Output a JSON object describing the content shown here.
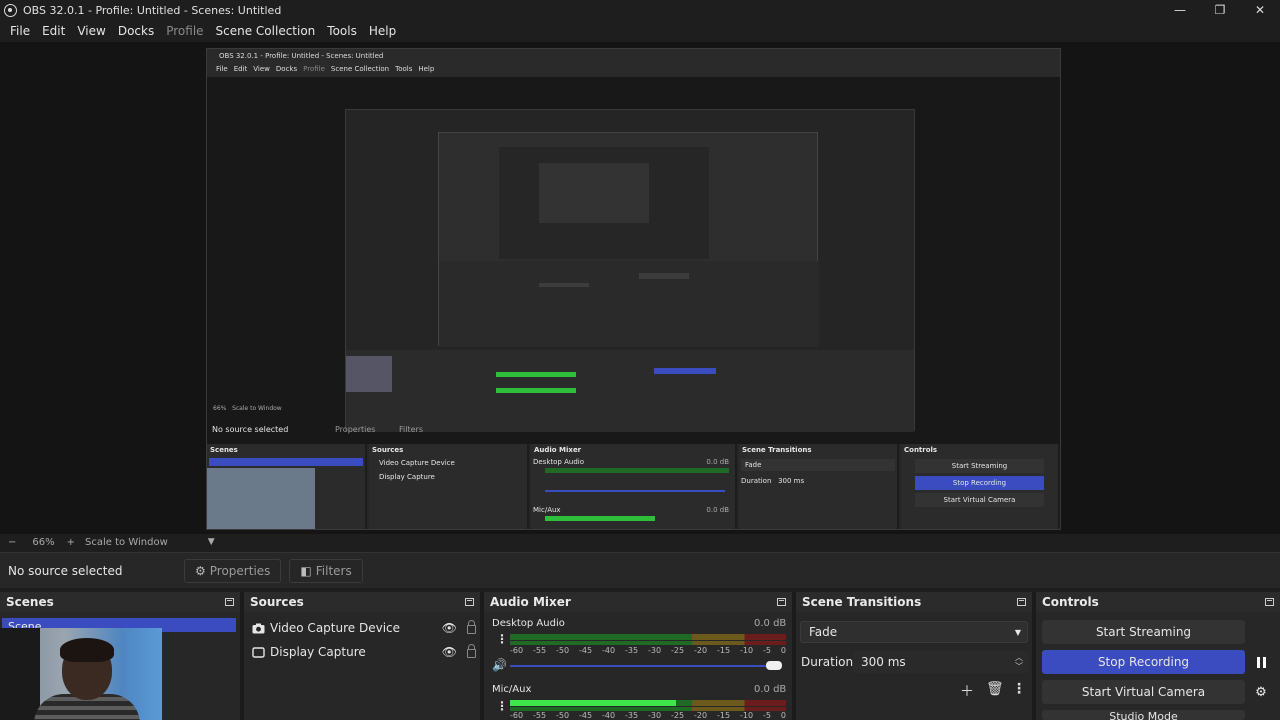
{
  "window": {
    "title": "OBS 32.0.1 - Profile: Untitled - Scenes: Untitled",
    "minimize_icon": "minimize-icon",
    "restore_icon": "restore-icon",
    "close_icon": "close-icon"
  },
  "menu": {
    "items": [
      "File",
      "Edit",
      "View",
      "Docks",
      "Profile",
      "Scene Collection",
      "Tools",
      "Help"
    ],
    "disabled": "Profile"
  },
  "zoom": {
    "minus": "−",
    "value": "66%",
    "plus": "+",
    "mode": "Scale to Window"
  },
  "source_bar": {
    "status": "No source selected",
    "properties_label": "Properties",
    "filters_label": "Filters"
  },
  "scenes": {
    "title": "Scenes",
    "items": [
      "Scene"
    ]
  },
  "sources": {
    "title": "Sources",
    "items": [
      {
        "name": "Video Capture Device",
        "icon": "camera-icon"
      },
      {
        "name": "Display Capture",
        "icon": "monitor-icon"
      }
    ]
  },
  "audio_mixer": {
    "title": "Audio Mixer",
    "channels": [
      {
        "name": "Desktop Audio",
        "db": "0.0 dB",
        "level": 0,
        "volume": 1.0
      },
      {
        "name": "Mic/Aux",
        "db": "0.0 dB",
        "level": 0.6,
        "volume": 1.0
      }
    ],
    "ticks": [
      "-60",
      "-55",
      "-50",
      "-45",
      "-40",
      "-35",
      "-30",
      "-25",
      "-20",
      "-15",
      "-10",
      "-5",
      "0"
    ]
  },
  "scene_transitions": {
    "title": "Scene Transitions",
    "transition": "Fade",
    "duration_label": "Duration",
    "duration_value": "300 ms"
  },
  "controls": {
    "title": "Controls",
    "start_streaming": "Start Streaming",
    "stop_recording": "Stop Recording",
    "start_virtual_camera": "Start Virtual Camera",
    "studio_mode": "Studio Mode"
  },
  "colors": {
    "accent": "#3a4cbf",
    "meter_green": "#3fe74b",
    "background": "#1e1e1e"
  },
  "nested_preview": {
    "title": "OBS 32.0.1 - Profile: Untitled - Scenes: Untitled",
    "menu": [
      "File",
      "Edit",
      "View",
      "Docks",
      "Profile",
      "Scene Collection",
      "Tools",
      "Help"
    ],
    "status": "No source selected",
    "zoom_value": "66%",
    "zoom_mode": "Scale to Window",
    "properties_label": "Properties",
    "filters_label": "Filters",
    "panels": [
      "Scenes",
      "Sources",
      "Audio Mixer",
      "Scene Transitions",
      "Controls"
    ],
    "sources": [
      "Video Capture Device",
      "Display Capture"
    ],
    "audio_channels": [
      "Desktop Audio",
      "Mic/Aux"
    ],
    "audio_db": "0.0 dB",
    "transition": "Fade",
    "duration_label": "Duration",
    "duration_value": "300 ms",
    "buttons": [
      "Start Streaming",
      "Stop Recording",
      "Start Virtual Camera"
    ]
  }
}
